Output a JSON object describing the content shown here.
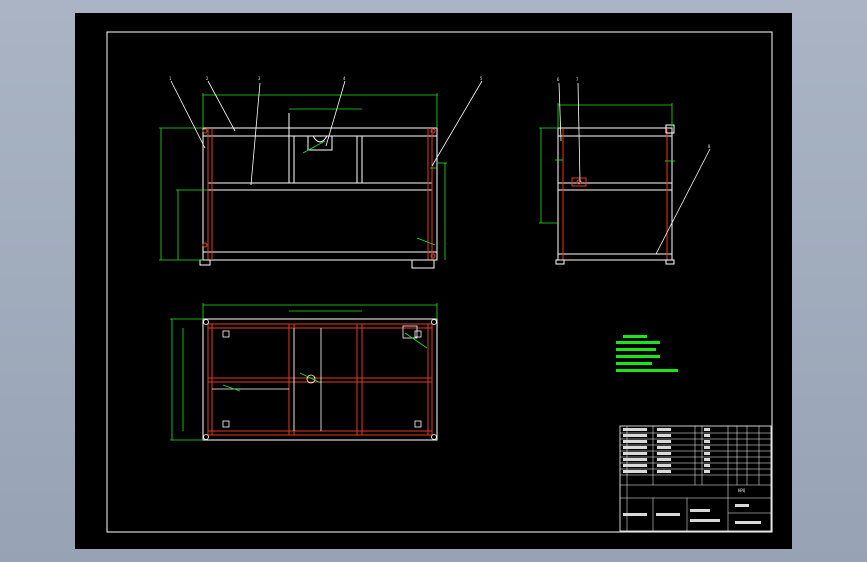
{
  "drawing": {
    "colors": {
      "background": "#000000",
      "frame": "#ffffff",
      "part_outline": "#ffffff",
      "frame_member": "#e33a1e",
      "dimension": "#1ee61e",
      "notes": "#19e619",
      "window_bg": "#a3aebf"
    },
    "front_view": {
      "balloons": [
        "1",
        "2",
        "3",
        "4",
        "5"
      ]
    },
    "side_view": {
      "balloons": [
        "6",
        "7",
        "8"
      ]
    },
    "title_block": {
      "title": "HPQ"
    }
  }
}
